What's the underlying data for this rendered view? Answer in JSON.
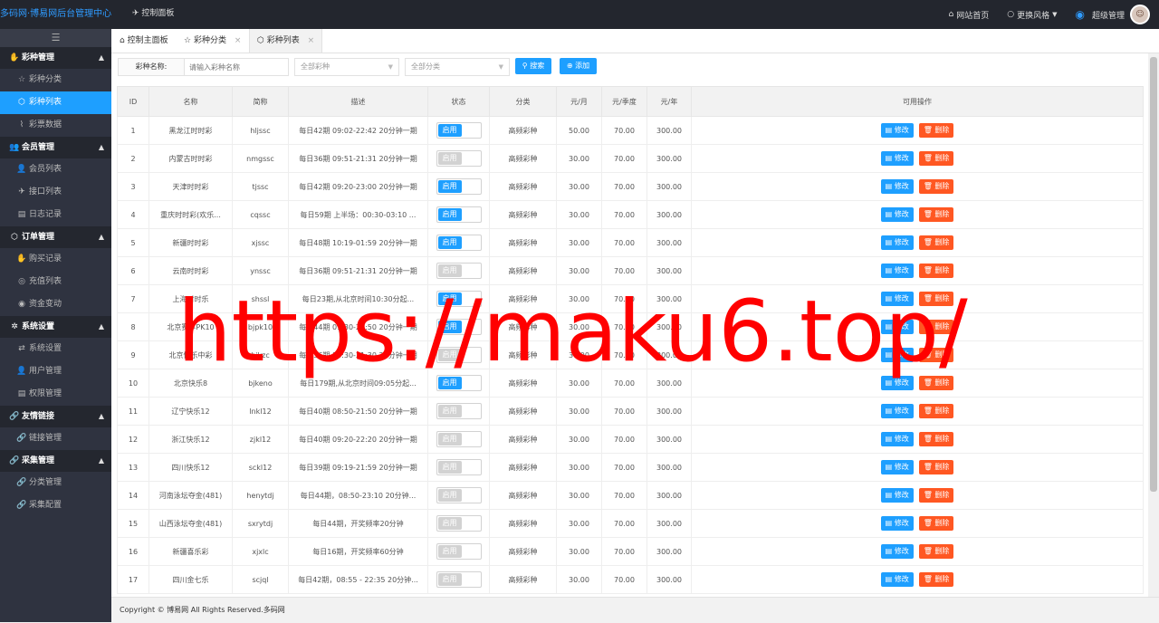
{
  "app": {
    "brand": "多码网·博易网后台管理中心"
  },
  "topbar": {
    "nav_label": "控制面板",
    "website_home": "网站首页",
    "change_style": "更换风格",
    "user": "超级管理"
  },
  "sidebar": {
    "groups": [
      {
        "label": "彩种管理",
        "items": [
          "彩种分类",
          "彩种列表",
          "彩票数据"
        ]
      },
      {
        "label": "会员管理",
        "items": [
          "会员列表",
          "接口列表",
          "日志记录"
        ]
      },
      {
        "label": "订单管理",
        "items": [
          "购买记录",
          "充值列表",
          "资金变动"
        ]
      },
      {
        "label": "系统设置",
        "items": [
          "系统设置",
          "用户管理",
          "权限管理"
        ]
      },
      {
        "label": "友情链接",
        "items": [
          "链接管理"
        ]
      },
      {
        "label": "采集管理",
        "items": [
          "分类管理",
          "采集配置"
        ]
      }
    ],
    "active": "彩种列表"
  },
  "tabs": [
    {
      "label": "控制主面板"
    },
    {
      "label": "彩种分类"
    },
    {
      "label": "彩种列表"
    }
  ],
  "filter": {
    "name_label": "彩种名称:",
    "name_placeholder": "请输入彩种名称",
    "lottery_select": "全部彩种",
    "category_select": "全部分类",
    "search_button": "搜索",
    "add_button": "添加"
  },
  "table": {
    "headers": [
      "ID",
      "名称",
      "简称",
      "描述",
      "状态",
      "分类",
      "元/月",
      "元/季度",
      "元/年",
      "可用操作"
    ],
    "status_label": "启用",
    "edit_label": "修改",
    "delete_label": "删除",
    "rows": [
      {
        "id": "1",
        "name": "黑龙江时时彩",
        "short": "hljssc",
        "desc": "每日42期 09:02-22:42 20分钟一期",
        "status": "on",
        "category": "高频彩种",
        "month": "50.00",
        "quarter": "70.00",
        "year": "300.00"
      },
      {
        "id": "2",
        "name": "内蒙古时时彩",
        "short": "nmgssc",
        "desc": "每日36期 09:51-21:31 20分钟一期",
        "status": "off",
        "category": "高频彩种",
        "month": "30.00",
        "quarter": "70.00",
        "year": "300.00"
      },
      {
        "id": "3",
        "name": "天津时时彩",
        "short": "tjssc",
        "desc": "每日42期 09:20-23:00 20分钟一期",
        "status": "on",
        "category": "高频彩种",
        "month": "30.00",
        "quarter": "70.00",
        "year": "300.00"
      },
      {
        "id": "4",
        "name": "重庆时时彩(欢乐...",
        "short": "cqssc",
        "desc": "每日59期 上半场：00:30-03:10 ...",
        "status": "on",
        "category": "高频彩种",
        "month": "30.00",
        "quarter": "70.00",
        "year": "300.00"
      },
      {
        "id": "5",
        "name": "新疆时时彩",
        "short": "xjssc",
        "desc": "每日48期 10:19-01:59 20分钟一期",
        "status": "on",
        "category": "高频彩种",
        "month": "30.00",
        "quarter": "70.00",
        "year": "300.00"
      },
      {
        "id": "6",
        "name": "云南时时彩",
        "short": "ynssc",
        "desc": "每日36期 09:51-21:31 20分钟一期",
        "status": "off",
        "category": "高频彩种",
        "month": "30.00",
        "quarter": "70.00",
        "year": "300.00"
      },
      {
        "id": "7",
        "name": "上海时时乐",
        "short": "shssl",
        "desc": "每日23期,从北京时间10:30分起...",
        "status": "on",
        "category": "高频彩种",
        "month": "30.00",
        "quarter": "70.00",
        "year": "300.00"
      },
      {
        "id": "8",
        "name": "北京赛车PK10",
        "short": "bjpk10",
        "desc": "每日44期 09:30-23:50 20分钟一期",
        "status": "on",
        "category": "高频彩种",
        "month": "30.00",
        "quarter": "70.00",
        "year": "300.00"
      },
      {
        "id": "9",
        "name": "北京快乐中彩",
        "short": "bjkzc",
        "desc": "每日36期 10:30-21:30 20分钟一期",
        "status": "off",
        "category": "高频彩种",
        "month": "30.00",
        "quarter": "70.00",
        "year": "300.00"
      },
      {
        "id": "10",
        "name": "北京快乐8",
        "short": "bjkeno",
        "desc": "每日179期,从北京时间09:05分起...",
        "status": "on",
        "category": "高频彩种",
        "month": "30.00",
        "quarter": "70.00",
        "year": "300.00"
      },
      {
        "id": "11",
        "name": "辽宁快乐12",
        "short": "lnkl12",
        "desc": "每日40期 08:50-21:50 20分钟一期",
        "status": "off",
        "category": "高频彩种",
        "month": "30.00",
        "quarter": "70.00",
        "year": "300.00"
      },
      {
        "id": "12",
        "name": "浙江快乐12",
        "short": "zjkl12",
        "desc": "每日40期 09:20-22:20 20分钟一期",
        "status": "off",
        "category": "高频彩种",
        "month": "30.00",
        "quarter": "70.00",
        "year": "300.00"
      },
      {
        "id": "13",
        "name": "四川快乐12",
        "short": "sckl12",
        "desc": "每日39期 09:19-21:59 20分钟一期",
        "status": "off",
        "category": "高频彩种",
        "month": "30.00",
        "quarter": "70.00",
        "year": "300.00"
      },
      {
        "id": "14",
        "name": "河南泳坛夺金(481)",
        "short": "henytdj",
        "desc": "每日44期，08:50-23:10 20分钟...",
        "status": "off",
        "category": "高频彩种",
        "month": "30.00",
        "quarter": "70.00",
        "year": "300.00"
      },
      {
        "id": "15",
        "name": "山西泳坛夺金(481)",
        "short": "sxrytdj",
        "desc": "每日44期，开奖频率20分钟",
        "status": "off",
        "category": "高频彩种",
        "month": "30.00",
        "quarter": "70.00",
        "year": "300.00"
      },
      {
        "id": "16",
        "name": "新疆喜乐彩",
        "short": "xjxlc",
        "desc": "每日16期，开奖频率60分钟",
        "status": "off",
        "category": "高频彩种",
        "month": "30.00",
        "quarter": "70.00",
        "year": "300.00"
      },
      {
        "id": "17",
        "name": "四川金七乐",
        "short": "scjql",
        "desc": "每日42期，08:55 - 22:35 20分钟...",
        "status": "off",
        "category": "高频彩种",
        "month": "30.00",
        "quarter": "70.00",
        "year": "300.00"
      }
    ]
  },
  "footer": {
    "text": "Copyright © 博易网 All Rights Reserved.多码网"
  },
  "watermark": "https://maku6.top/",
  "colors": {
    "primary": "#1e9fff",
    "danger": "#ff5722",
    "sidebar": "#2f3340",
    "topbar": "#23262e",
    "watermark": "#ff0000"
  }
}
